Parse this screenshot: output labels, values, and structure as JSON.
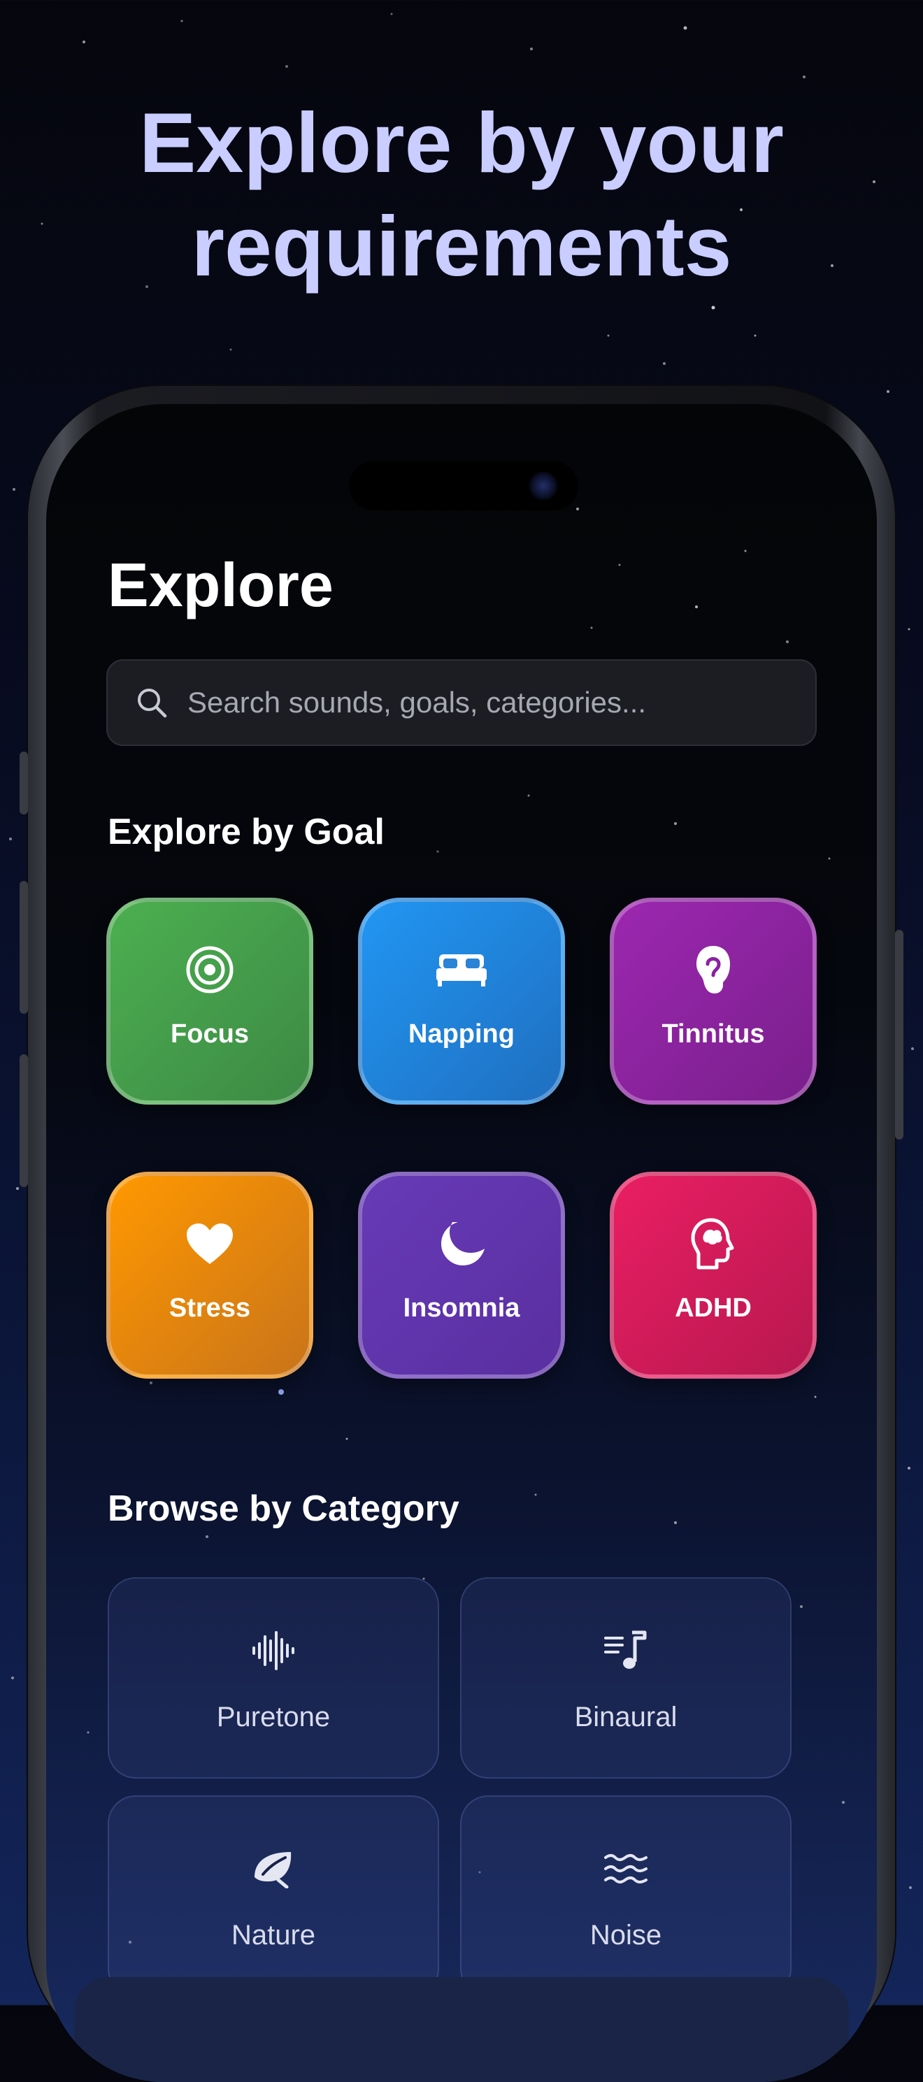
{
  "headline": {
    "line1": "Explore by your",
    "line2": "requirements"
  },
  "screen": {
    "title": "Explore",
    "search": {
      "placeholder": "Search sounds, goals, categories...",
      "icon": "search-icon"
    },
    "goals_section_title": "Explore by Goal",
    "goals": [
      {
        "label": "Focus",
        "icon": "target-icon",
        "color_from": "#4caf50",
        "color_to": "#3d8a45"
      },
      {
        "label": "Napping",
        "icon": "bed-icon",
        "color_from": "#2196f3",
        "color_to": "#1f6fc0"
      },
      {
        "label": "Tinnitus",
        "icon": "ear-icon",
        "color_from": "#9c27b0",
        "color_to": "#7a1f8c"
      },
      {
        "label": "Stress",
        "icon": "heart-icon",
        "color_from": "#ff9800",
        "color_to": "#c9741a"
      },
      {
        "label": "Insomnia",
        "icon": "moon-icon",
        "color_from": "#673ab7",
        "color_to": "#5a2fa0"
      },
      {
        "label": "ADHD",
        "icon": "brain-icon",
        "color_from": "#e91e63",
        "color_to": "#b8184f"
      }
    ],
    "categories_section_title": "Browse by Category",
    "categories": [
      {
        "label": "Puretone",
        "icon": "waveform-icon"
      },
      {
        "label": "Binaural",
        "icon": "music-list-icon"
      },
      {
        "label": "Nature",
        "icon": "leaf-icon"
      },
      {
        "label": "Noise",
        "icon": "waves-icon"
      }
    ]
  }
}
